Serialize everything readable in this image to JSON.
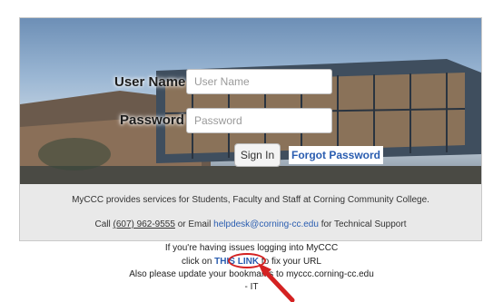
{
  "login": {
    "username_label": "User Name",
    "username_placeholder": "User Name",
    "password_label": "Password",
    "password_placeholder": "Password",
    "signin_label": "Sign In",
    "forgot_label": "Forgot Password"
  },
  "info": {
    "services_text": "MyCCC provides services for Students, Faculty and Staff at Corning Community College.",
    "call_prefix": "Call ",
    "phone": "(607) 962-9555",
    "email_prefix": " or Email ",
    "email": "helpdesk@corning-cc.edu",
    "support_suffix": " for Technical Support"
  },
  "notice": {
    "line1": "If you're having issues logging into MyCCC",
    "line2_prefix": "click on ",
    "link_label": "THIS LINK",
    "line2_suffix": " to fix your URL",
    "line3": "Also please update your bookmarks to myccc.corning-cc.edu",
    "line4": "- IT"
  },
  "colors": {
    "link": "#2a5db0",
    "annotation": "#d42222"
  }
}
